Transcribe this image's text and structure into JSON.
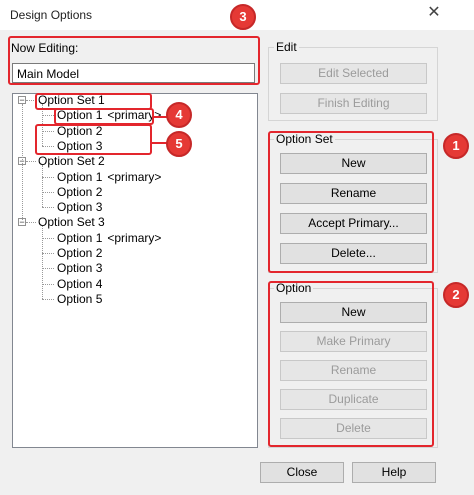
{
  "window": {
    "title": "Design Options",
    "close_glyph": "✕"
  },
  "now_editing": {
    "label": "Now Editing:",
    "value": "Main Model"
  },
  "edit": {
    "caption": "Edit",
    "buttons": [
      {
        "label": "Edit Selected",
        "enabled": false
      },
      {
        "label": "Finish Editing",
        "enabled": false
      }
    ]
  },
  "option_set": {
    "caption": "Option Set",
    "buttons": [
      {
        "label": "New",
        "enabled": true
      },
      {
        "label": "Rename",
        "enabled": true
      },
      {
        "label": "Accept Primary...",
        "enabled": true
      },
      {
        "label": "Delete...",
        "enabled": true
      }
    ]
  },
  "option": {
    "caption": "Option",
    "buttons": [
      {
        "label": "New",
        "enabled": true
      },
      {
        "label": "Make Primary",
        "enabled": false
      },
      {
        "label": "Rename",
        "enabled": false
      },
      {
        "label": "Duplicate",
        "enabled": false
      },
      {
        "label": "Delete",
        "enabled": false
      }
    ]
  },
  "tree": {
    "expander_glyph": "−",
    "sets": [
      {
        "label": "Option Set 1",
        "options": [
          {
            "label": "Option 1",
            "tag": "<primary>"
          },
          {
            "label": "Option 2",
            "tag": ""
          },
          {
            "label": "Option 3",
            "tag": ""
          }
        ]
      },
      {
        "label": "Option Set 2",
        "options": [
          {
            "label": "Option 1",
            "tag": "<primary>"
          },
          {
            "label": "Option 2",
            "tag": ""
          },
          {
            "label": "Option 3",
            "tag": ""
          }
        ]
      },
      {
        "label": "Option Set 3",
        "options": [
          {
            "label": "Option 1",
            "tag": "<primary>"
          },
          {
            "label": "Option 2",
            "tag": ""
          },
          {
            "label": "Option 3",
            "tag": ""
          },
          {
            "label": "Option 4",
            "tag": ""
          },
          {
            "label": "Option 5",
            "tag": ""
          }
        ]
      }
    ]
  },
  "footer": {
    "close_label": "Close",
    "help_label": "Help"
  },
  "callouts": {
    "b1": "1",
    "b2": "2",
    "b3": "3",
    "b4": "4",
    "b5": "5"
  },
  "colors": {
    "callout_red": "#e3262d",
    "window_bg": "#f0f0f0"
  }
}
